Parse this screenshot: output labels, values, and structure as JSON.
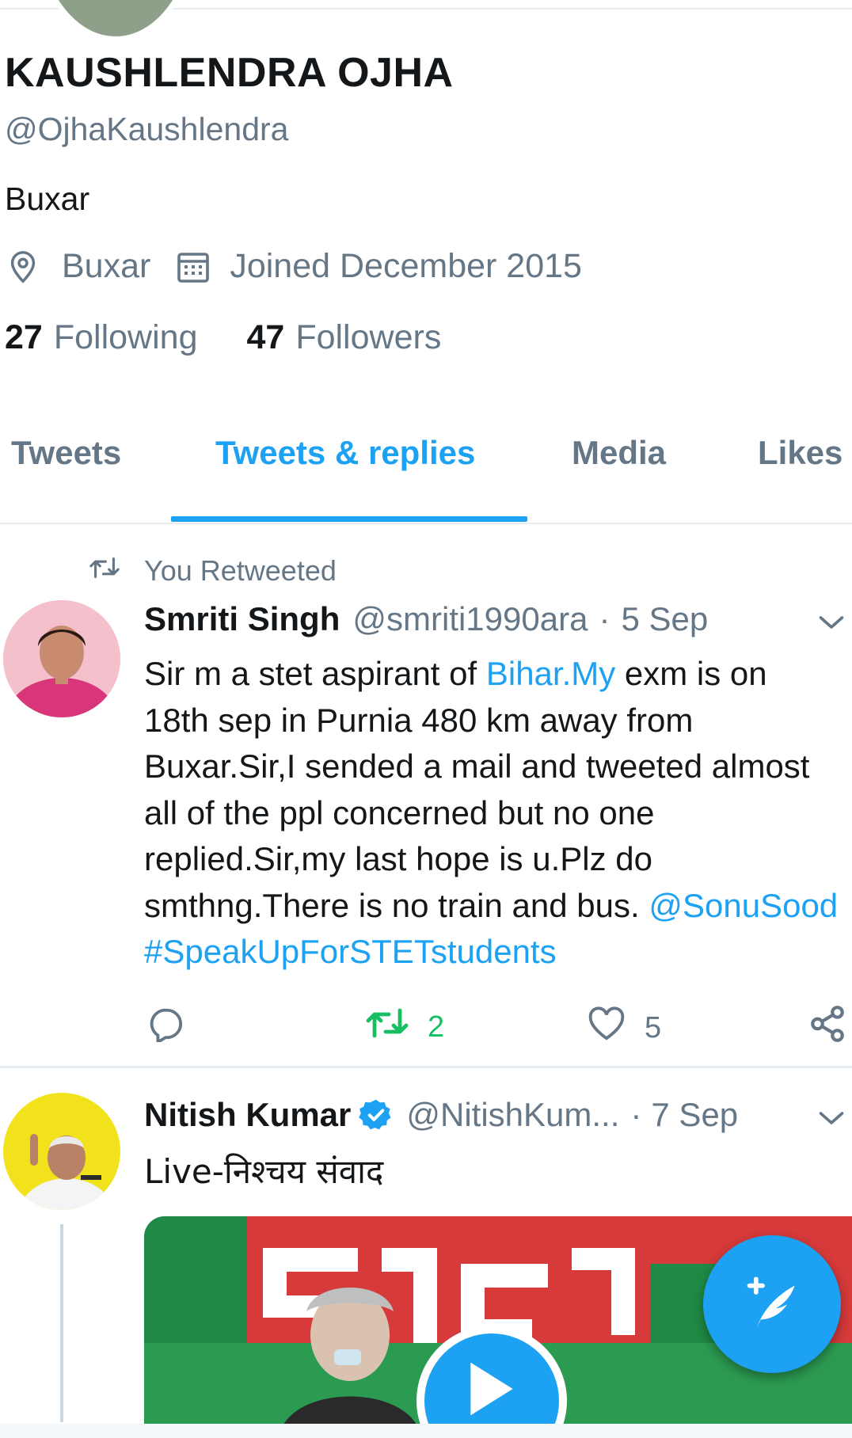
{
  "profile": {
    "name": "KAUSHLENDRA OJHA",
    "handle": "@OjhaKaushlendra",
    "bio": "Buxar",
    "location": "Buxar",
    "joined": "Joined December 2015",
    "following_count": "27",
    "following_label": "Following",
    "followers_count": "47",
    "followers_label": "Followers"
  },
  "tabs": [
    {
      "label": "Tweets"
    },
    {
      "label": "Tweets & replies"
    },
    {
      "label": "Media"
    },
    {
      "label": "Likes"
    }
  ],
  "active_tab": "Tweets & replies",
  "tweets": [
    {
      "context": "You Retweeted",
      "name": "Smriti Singh",
      "handle": "@smriti1990ara",
      "dot": "·",
      "time": "5 Sep",
      "text_1": "Sir  m a stet aspirant of ",
      "link_1": "Bihar.My",
      "text_2": " exm is on 18th sep in Purnia 480 km away from Buxar.Sir,I sended a mail and tweeted almost all of the ppl concerned but no one replied.Sir,my last hope is u.Plz do smthng.There is no train and bus. ",
      "mention": "@SonuSood",
      "hashtag": "#SpeakUpForSTETstudents",
      "retweets": "2",
      "likes": "5"
    },
    {
      "name": "Nitish Kumar",
      "handle": "@NitishKum...",
      "dot": "·",
      "time": "7 Sep",
      "text": "Live-निश्चय संवाद"
    }
  ],
  "colors": {
    "accent": "#1da1f2",
    "secondary_text": "#657786",
    "retweet_green": "#17bf63"
  },
  "icons": [
    "location-icon",
    "calendar-icon",
    "retweet-icon",
    "reply-icon",
    "like-icon",
    "share-icon",
    "chevron-down-icon",
    "verified-icon",
    "play-icon",
    "compose-icon"
  ]
}
